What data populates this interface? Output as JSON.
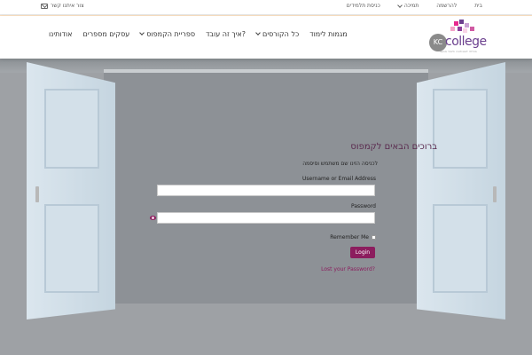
{
  "topbar": {
    "contact": "צור איתנו קשר",
    "nav": [
      {
        "label": "בית",
        "has_dropdown": false
      },
      {
        "label": "להרשמה",
        "has_dropdown": false
      },
      {
        "label": "תמיכה",
        "has_dropdown": true
      },
      {
        "label": "כניסת תלמידים",
        "has_dropdown": false
      }
    ]
  },
  "header": {
    "logo": {
      "kc": "KC",
      "college": "college",
      "tagline": "מכללה לטכנולוגיה ולימודי מחשב"
    },
    "nav": [
      {
        "label": "אודותינו",
        "has_dropdown": false
      },
      {
        "label": "עסקים מספרים",
        "has_dropdown": false
      },
      {
        "label": "ספריית הקמפוס",
        "has_dropdown": true
      },
      {
        "label": "איך זה עובד?",
        "has_dropdown": false
      },
      {
        "label": "כל הקורסים",
        "has_dropdown": false
      },
      {
        "label": "מגמות לימוד",
        "has_dropdown": true
      }
    ]
  },
  "login": {
    "welcome": "ברוכים הבאים לקמפוס",
    "subtitle": "לכניסה הזינו שם משתמש וסיסמה",
    "username_label": "Username or Email Address",
    "username_value": "",
    "password_label": "Password",
    "password_value": "",
    "remember_label": "Remember Me",
    "remember_checked": false,
    "login_button": "Login",
    "lost_password": "Lost your Password?"
  },
  "colors": {
    "brand": "#8c1d5e",
    "logo_purple": "#6b3f8e",
    "welcome_text": "#5a2a4e",
    "hero_bg": "#9ea1a5"
  }
}
